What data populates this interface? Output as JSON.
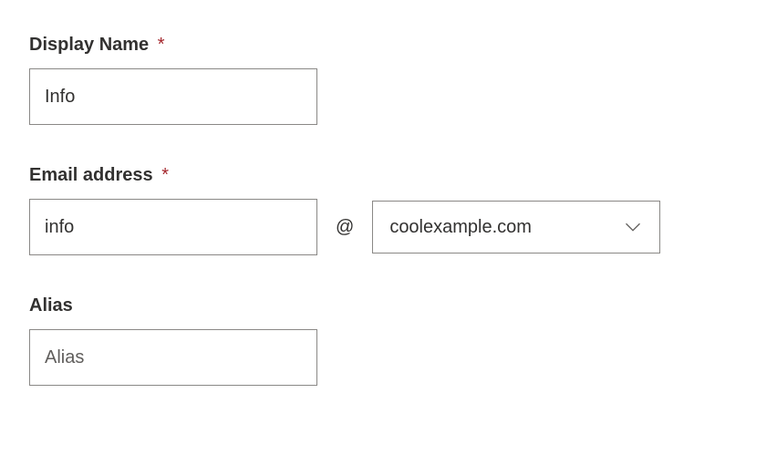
{
  "form": {
    "display_name": {
      "label": "Display Name",
      "required_marker": "*",
      "value": "Info"
    },
    "email_address": {
      "label": "Email address",
      "required_marker": "*",
      "local_value": "info",
      "at_symbol": "@",
      "domain_selected": "coolexample.com"
    },
    "alias": {
      "label": "Alias",
      "placeholder": "Alias",
      "value": ""
    }
  }
}
